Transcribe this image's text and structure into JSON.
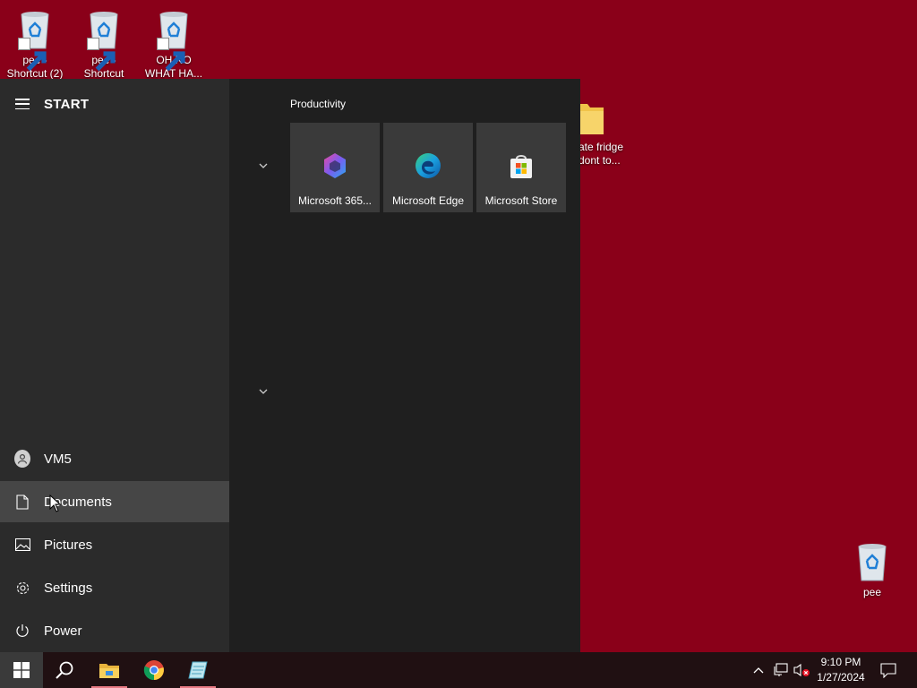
{
  "desktop": {
    "icons": [
      {
        "label_line1": "pee -",
        "label_line2": "Shortcut (2)"
      },
      {
        "label_line1": "pee -",
        "label_line2": "Shortcut"
      },
      {
        "label_line1": "OH NO",
        "label_line2": "WHAT HA..."
      }
    ],
    "folder": {
      "label_line1": "ate fridge",
      "label_line2": "dont to..."
    },
    "bin_icon": {
      "label": "pee"
    }
  },
  "start_menu": {
    "title": "START",
    "left_items": [
      {
        "label": "VM5",
        "icon": "user-icon"
      },
      {
        "label": "Documents",
        "icon": "document-icon"
      },
      {
        "label": "Pictures",
        "icon": "pictures-icon"
      },
      {
        "label": "Settings",
        "icon": "gear-icon"
      },
      {
        "label": "Power",
        "icon": "power-icon"
      }
    ],
    "group_title": "Productivity",
    "tiles": [
      {
        "label": "Microsoft 365...",
        "icon": "microsoft-365-icon"
      },
      {
        "label": "Microsoft Edge",
        "icon": "edge-icon"
      },
      {
        "label": "Microsoft Store",
        "icon": "store-icon"
      }
    ]
  },
  "taskbar": {
    "time": "9:10 PM",
    "date": "1/27/2024",
    "pinned": [
      "windows-start-icon",
      "search-icon",
      "file-explorer-icon",
      "chrome-icon",
      "notepad-app-icon"
    ]
  },
  "colors": {
    "desktop_bg": "#8a0019",
    "menu_bg": "#1f1f1f",
    "menu_left_bg": "#2b2b2b",
    "tile_bg": "#3a3a3a",
    "taskbar_bg": "#201012"
  }
}
